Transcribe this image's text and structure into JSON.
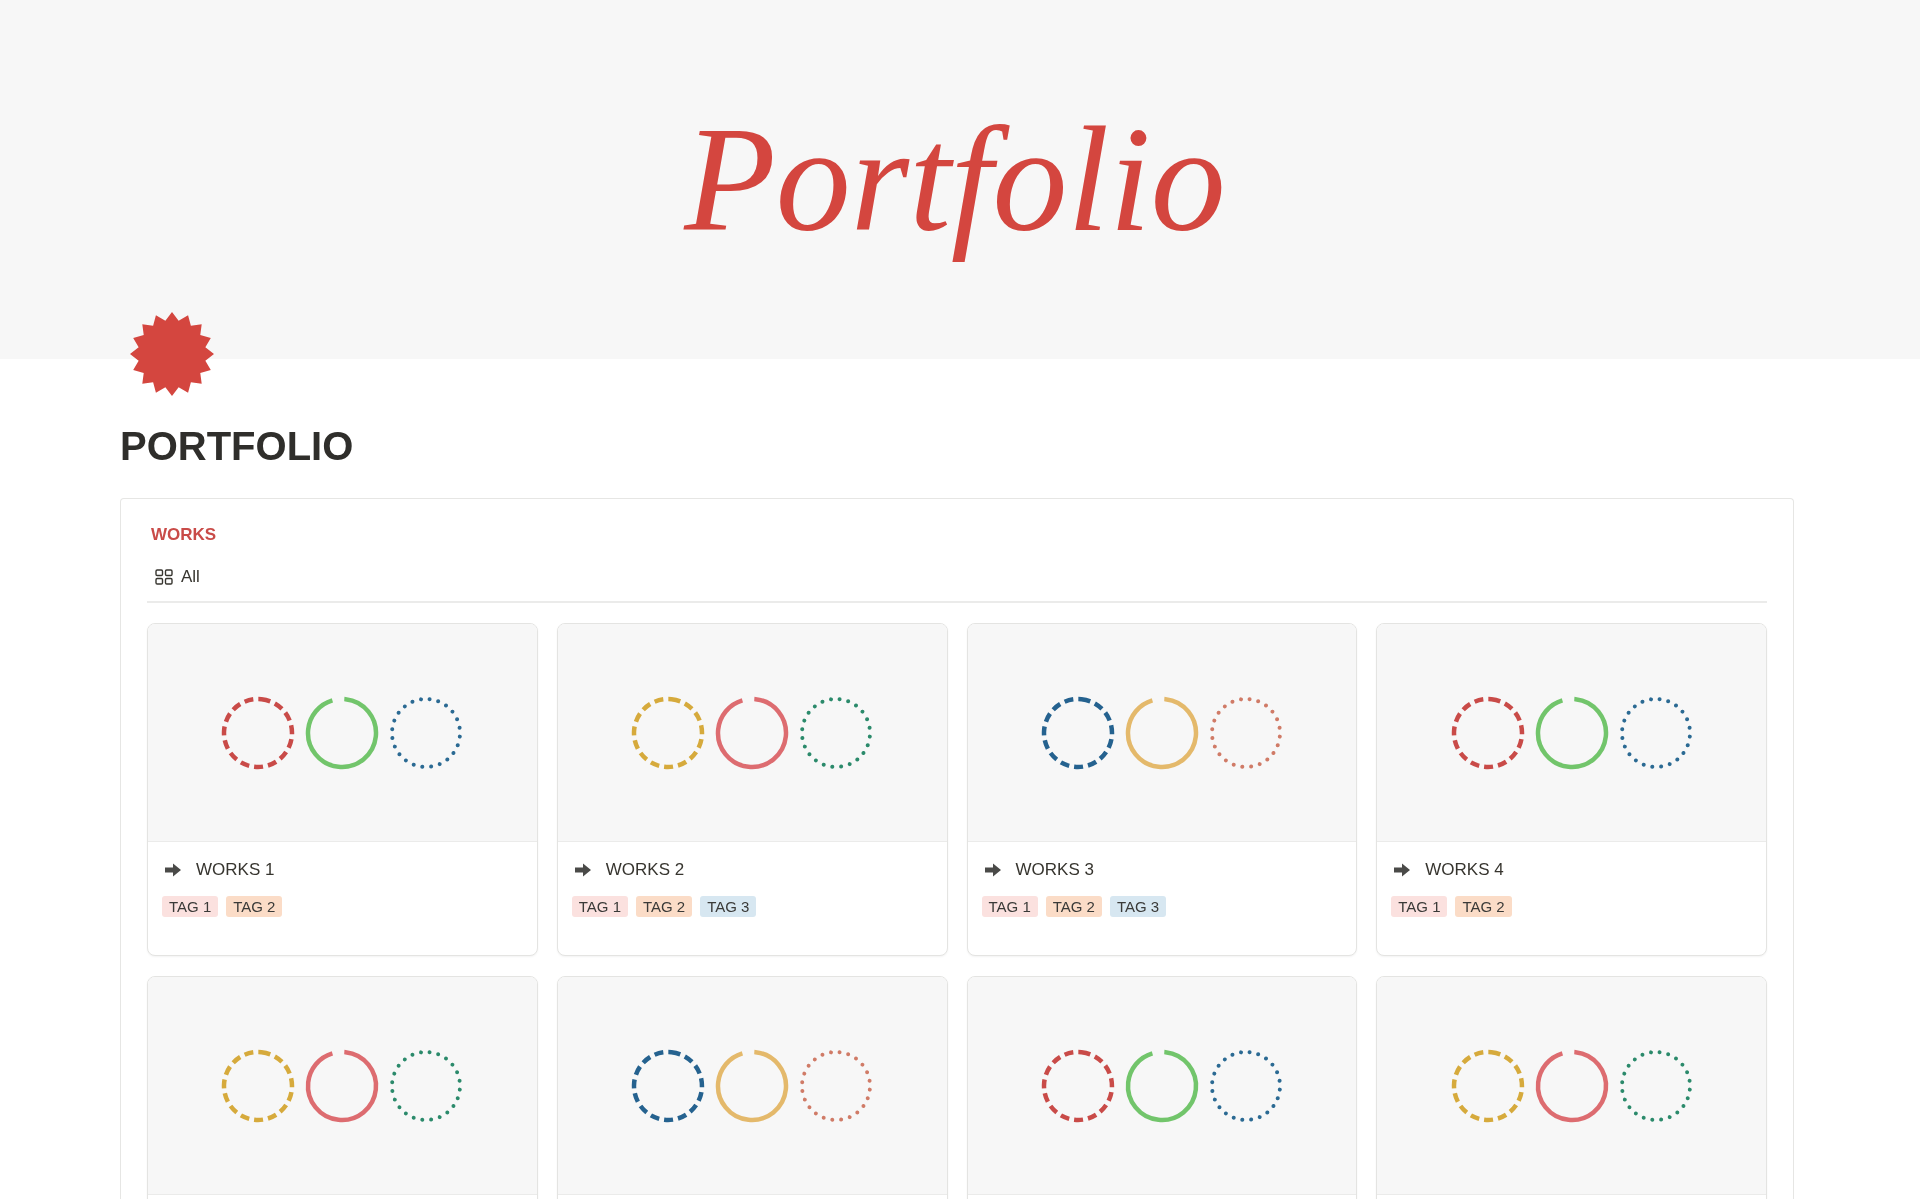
{
  "cover": {
    "title": "Portfolio"
  },
  "page": {
    "title": "PORTFOLIO"
  },
  "database": {
    "title": "WORKS",
    "views": [
      {
        "label": "All",
        "selected": true
      }
    ],
    "cards": [
      {
        "title": "WORKS 1",
        "rings": [
          {
            "kind": "dashed",
            "color": "#c94b48"
          },
          {
            "kind": "solid",
            "color": "#72c56b"
          },
          {
            "kind": "dotted",
            "color": "#2b6a93"
          }
        ],
        "tags": [
          {
            "label": "TAG 1",
            "color": "#fbe1df"
          },
          {
            "label": "TAG 2",
            "color": "#fbdcc7"
          }
        ]
      },
      {
        "title": "WORKS 2",
        "rings": [
          {
            "kind": "dashed",
            "color": "#d6aa3c"
          },
          {
            "kind": "solid",
            "color": "#dd6c70"
          },
          {
            "kind": "dotted",
            "color": "#2b8a6b"
          }
        ],
        "tags": [
          {
            "label": "TAG 1",
            "color": "#fbe1df"
          },
          {
            "label": "TAG 2",
            "color": "#fbdcc7"
          },
          {
            "label": "TAG 3",
            "color": "#d7e7f1"
          }
        ]
      },
      {
        "title": "WORKS 3",
        "rings": [
          {
            "kind": "dashed",
            "color": "#25628f"
          },
          {
            "kind": "solid",
            "color": "#e4b96b"
          },
          {
            "kind": "dotted",
            "color": "#d07b67"
          }
        ],
        "tags": [
          {
            "label": "TAG 1",
            "color": "#fbe1df"
          },
          {
            "label": "TAG 2",
            "color": "#fbdcc7"
          },
          {
            "label": "TAG 3",
            "color": "#d7e7f1"
          }
        ]
      },
      {
        "title": "WORKS 4",
        "rings": [
          {
            "kind": "dashed",
            "color": "#c94b48"
          },
          {
            "kind": "solid",
            "color": "#72c56b"
          },
          {
            "kind": "dotted",
            "color": "#2b6a93"
          }
        ],
        "tags": [
          {
            "label": "TAG 1",
            "color": "#fbe1df"
          },
          {
            "label": "TAG 2",
            "color": "#fbdcc7"
          }
        ]
      },
      {
        "rings": [
          {
            "kind": "dashed",
            "color": "#d6aa3c"
          },
          {
            "kind": "solid",
            "color": "#dd6c70"
          },
          {
            "kind": "dotted",
            "color": "#2b8a6b"
          }
        ]
      },
      {
        "rings": [
          {
            "kind": "dashed",
            "color": "#25628f"
          },
          {
            "kind": "solid",
            "color": "#e4b96b"
          },
          {
            "kind": "dotted",
            "color": "#d07b67"
          }
        ]
      },
      {
        "rings": [
          {
            "kind": "dashed",
            "color": "#c94b48"
          },
          {
            "kind": "solid",
            "color": "#72c56b"
          },
          {
            "kind": "dotted",
            "color": "#2b6a93"
          }
        ]
      },
      {
        "rings": [
          {
            "kind": "dashed",
            "color": "#d6aa3c"
          },
          {
            "kind": "solid",
            "color": "#dd6c70"
          },
          {
            "kind": "dotted",
            "color": "#2b8a6b"
          }
        ]
      }
    ]
  }
}
